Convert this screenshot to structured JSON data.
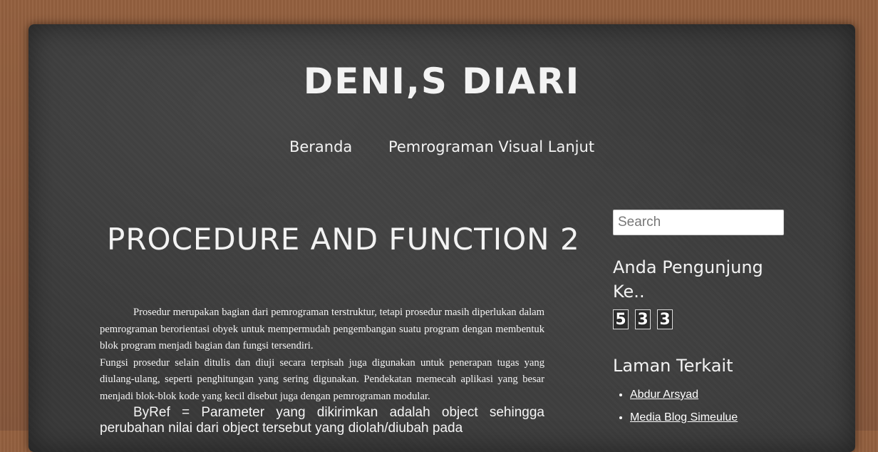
{
  "blog": {
    "title": "DENI,S DIARI"
  },
  "nav": {
    "items": [
      {
        "label": "Beranda"
      },
      {
        "label": "Pemrograman Visual Lanjut"
      }
    ]
  },
  "post": {
    "title": "PROCEDURE AND FUNCTION 2",
    "paragraphs": [
      "Prosedur merupakan bagian dari pemrograman terstruktur, tetapi prosedur masih diperlukan dalam pemrograman berorientasi obyek untuk mempermudah pengembangan suatu program dengan membentuk blok program menjadi bagian dan fungsi tersendiri.",
      "Fungsi prosedur selain ditulis dan diuji secara terpisah juga digunakan untuk penerapan tugas yang diulang-ulang, seperti penghitungan yang sering digunakan. Pendekatan memecah aplikasi yang besar menjadi blok-blok kode yang kecil disebut juga dengan pemrograman modular.",
      "ByRef = Parameter yang dikirimkan adalah object sehingga perubahan nilai dari object tersebut yang diolah/diubah pada"
    ]
  },
  "sidebar": {
    "search_placeholder": "Search",
    "visitor_title": "Anda Pengunjung Ke..",
    "visitor_digits": [
      "5",
      "3",
      "3"
    ],
    "links_title": "Laman Terkait",
    "links": [
      {
        "label": "Abdur Arsyad"
      },
      {
        "label": "Media Blog Simeulue"
      }
    ]
  }
}
